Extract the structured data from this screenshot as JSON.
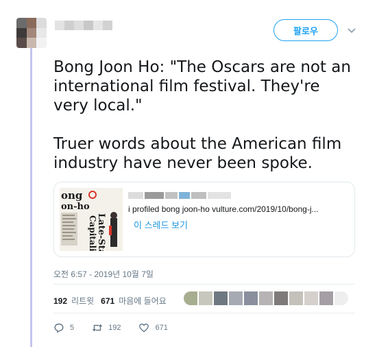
{
  "tweet": {
    "follow_label": "팔로우",
    "text": "Bong Joon Ho: \"The Oscars are not an international film festival. They're very local.\"\n\nTruer words about the American film industry have never been spoke.",
    "timestamp": "오전 6:57 - 2019년 10월 7일"
  },
  "card": {
    "thumb_text": [
      "ong",
      "on-ho",
      "Late-Stage",
      "Capitalism"
    ],
    "description": "i profiled bong joon-ho vulture.com/2019/10/bong-j...",
    "link": "이 스레드 보기"
  },
  "stats": {
    "retweets_count": "192",
    "retweets_label": "리트윗",
    "likes_count": "671",
    "likes_label": "마음에 들어요"
  },
  "actions": {
    "reply_count": "5",
    "retweet_count": "192",
    "like_count": "671"
  },
  "icons": [
    "chevron-down-icon",
    "reply-icon",
    "retweet-icon",
    "heart-icon"
  ],
  "colors": {
    "accent": "#1da1f2",
    "link": "#1b95e0",
    "thread_line": "#c4c4ee",
    "muted": "#657786"
  }
}
